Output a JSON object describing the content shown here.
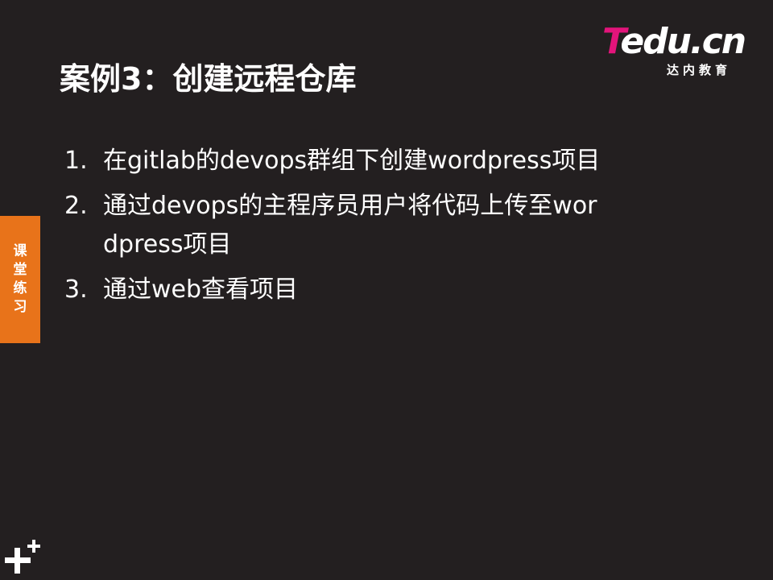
{
  "logo": {
    "brand_t": "T",
    "brand_rest": "edu.cn",
    "subtitle": "达内教育",
    "accent_color": "#e3147b"
  },
  "slide": {
    "title": "案例3：创建远程仓库",
    "items": [
      {
        "num": "1.",
        "text": "在gitlab的devops群组下创建wordpress项目"
      },
      {
        "num": "2.",
        "text": "通过devops的主程序员用户将代码上传至wordpress项目"
      },
      {
        "num": "3.",
        "text": "通过web查看项目"
      }
    ]
  },
  "side_tab": {
    "label": "课堂练习",
    "color": "#e8731a"
  },
  "decor": {
    "icon": "plus-icon"
  }
}
